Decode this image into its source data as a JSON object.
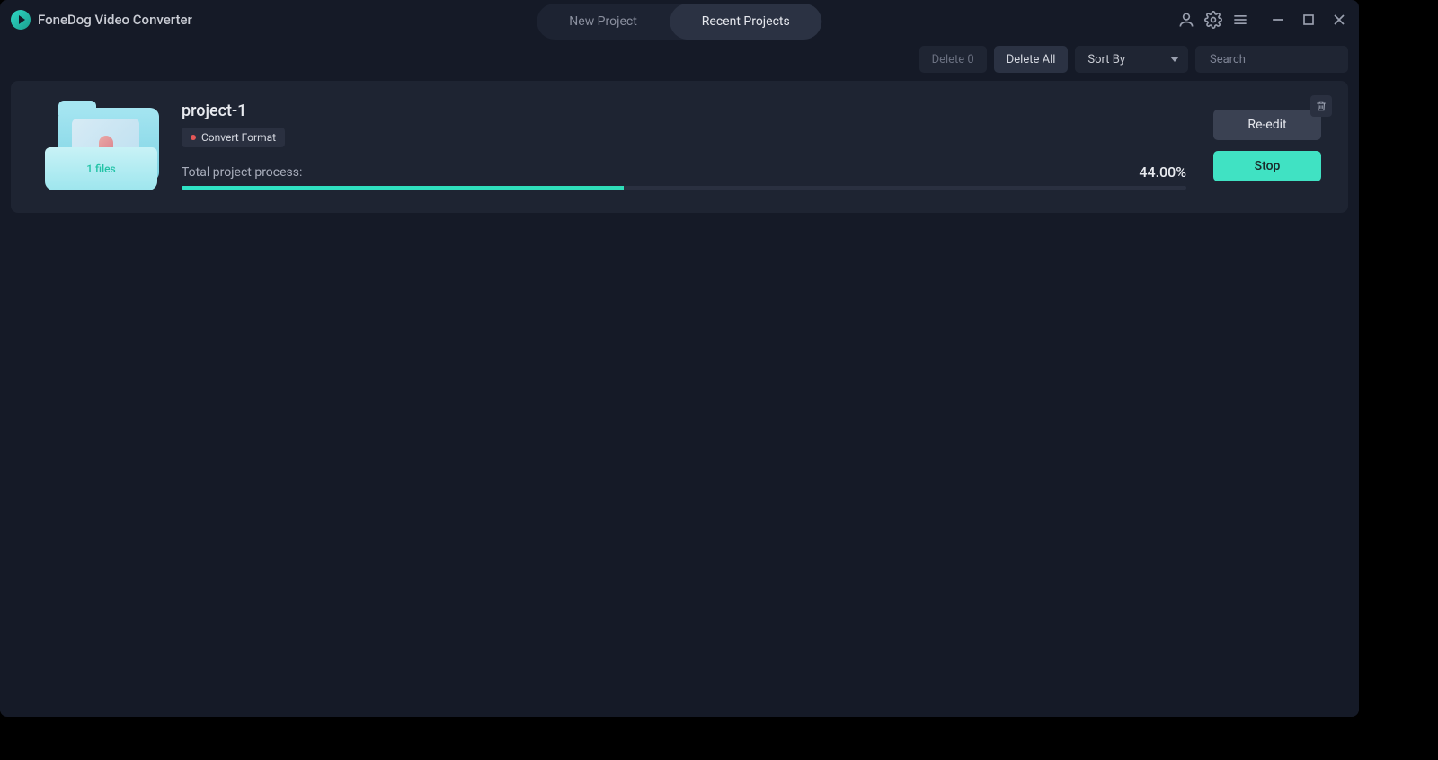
{
  "app": {
    "title": "FoneDog Video Converter"
  },
  "tabs": {
    "new": "New Project",
    "recent": "Recent Projects"
  },
  "toolbar": {
    "delete0": "Delete 0",
    "deleteAll": "Delete All",
    "sortBy": "Sort By",
    "searchPlaceholder": "Search"
  },
  "project": {
    "filesLabel": "1 files",
    "name": "project-1",
    "badge": "Convert Format",
    "progressLabel": "Total project process:",
    "percent": "44.00%",
    "progressWidth": "44%",
    "reedit": "Re-edit",
    "stop": "Stop"
  }
}
